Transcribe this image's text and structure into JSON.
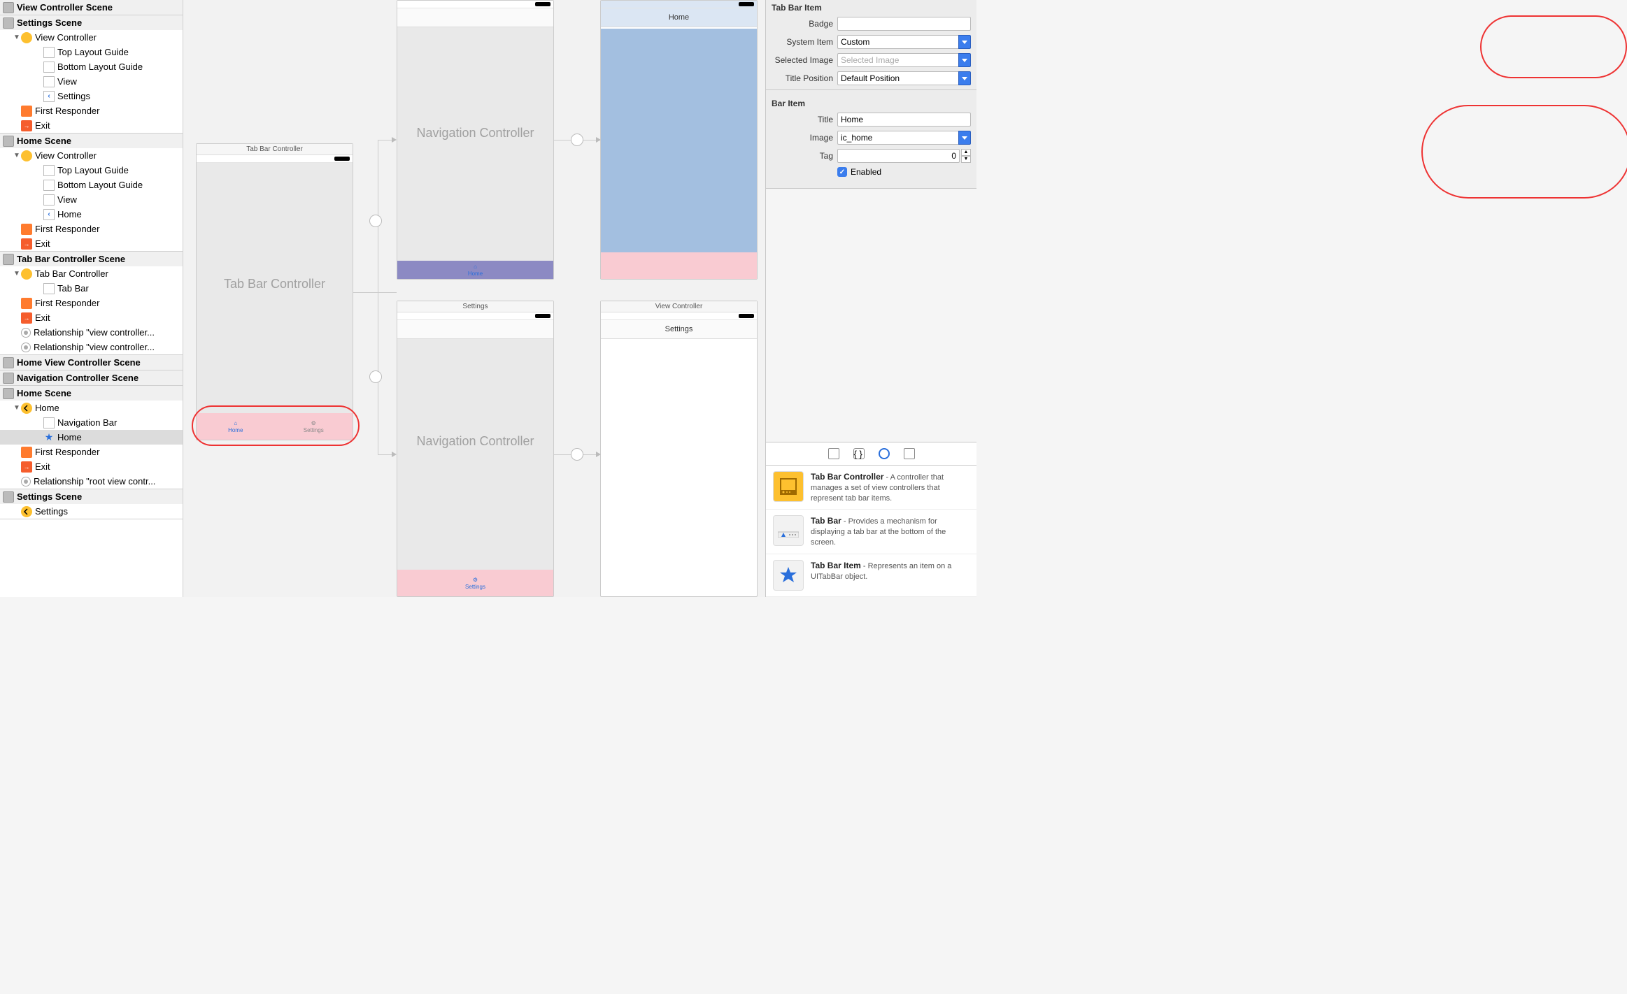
{
  "outline": {
    "scenes": [
      {
        "title": "View Controller Scene",
        "items": []
      },
      {
        "title": "Settings Scene",
        "items": [
          {
            "label": "View Controller",
            "children": [
              {
                "label": "Top Layout Guide"
              },
              {
                "label": "Bottom Layout Guide"
              },
              {
                "label": "View"
              },
              {
                "label": "Settings",
                "chev": true
              }
            ]
          },
          {
            "label": "First Responder",
            "orange": true
          },
          {
            "label": "Exit",
            "orangeR": true
          }
        ]
      },
      {
        "title": "Home Scene",
        "items": [
          {
            "label": "View Controller",
            "children": [
              {
                "label": "Top Layout Guide"
              },
              {
                "label": "Bottom Layout Guide"
              },
              {
                "label": "View"
              },
              {
                "label": "Home",
                "chev": true
              }
            ]
          },
          {
            "label": "First Responder",
            "orange": true
          },
          {
            "label": "Exit",
            "orangeR": true
          }
        ]
      },
      {
        "title": "Tab Bar Controller Scene",
        "items": [
          {
            "label": "Tab Bar Controller",
            "children": [
              {
                "label": "Tab Bar"
              }
            ]
          },
          {
            "label": "First Responder",
            "orange": true
          },
          {
            "label": "Exit",
            "orangeR": true
          },
          {
            "label": "Relationship \"view controller...",
            "rel": true
          },
          {
            "label": "Relationship \"view controller...",
            "rel": true
          }
        ]
      },
      {
        "title": "Home View Controller Scene",
        "items": []
      },
      {
        "title": "Navigation Controller Scene",
        "items": []
      },
      {
        "title": "Home Scene 2",
        "titleDisplay": "Home Scene",
        "items": [
          {
            "label": "Home",
            "yback": true,
            "children": [
              {
                "label": "Navigation Bar"
              },
              {
                "label": "Home",
                "star": true,
                "selected": true
              }
            ]
          },
          {
            "label": "First Responder",
            "orange": true
          },
          {
            "label": "Exit",
            "orangeR": true
          },
          {
            "label": "Relationship \"root view contr...",
            "rel": true
          }
        ]
      },
      {
        "title": "Settings Scene 2",
        "titleDisplay": "Settings Scene",
        "items": [
          {
            "label": "Settings",
            "yback": true
          }
        ]
      }
    ]
  },
  "canvas": {
    "tabbarvc": {
      "title": "Tab Bar Controller",
      "bigLabel": "Tab Bar Controller",
      "tabs": [
        {
          "label": "Home",
          "icon": "home"
        },
        {
          "label": "Settings",
          "icon": "gear"
        }
      ]
    },
    "nav1": {
      "title": "",
      "bigLabel": "Navigation Controller",
      "tab": "Home"
    },
    "nav2": {
      "title": "Settings",
      "bigLabel": "Navigation Controller",
      "tab": "Settings"
    },
    "homevc": {
      "nav": "Home"
    },
    "settingsvc": {
      "title": "View Controller",
      "nav": "Settings"
    }
  },
  "inspector": {
    "tabBarItem": {
      "title_section": "Tab Bar Item",
      "badge_label": "Badge",
      "badge_value": "",
      "system_item_label": "System Item",
      "system_item_value": "Custom",
      "selected_image_label": "Selected Image",
      "selected_image_placeholder": "Selected Image",
      "title_position_label": "Title Position",
      "title_position_value": "Default Position"
    },
    "barItem": {
      "title_section": "Bar Item",
      "title_label": "Title",
      "title_value": "Home",
      "image_label": "Image",
      "image_value": "ic_home",
      "tag_label": "Tag",
      "tag_value": "0",
      "enabled_label": "Enabled"
    }
  },
  "library": {
    "items": [
      {
        "name": "Tab Bar Controller",
        "desc": " - A controller that manages a set of view controllers that represent tab bar items."
      },
      {
        "name": "Tab Bar",
        "desc": " - Provides a mechanism for displaying a tab bar at the bottom of the screen."
      },
      {
        "name": "Tab Bar Item",
        "desc": " - Represents an item on a UITabBar object."
      }
    ]
  }
}
